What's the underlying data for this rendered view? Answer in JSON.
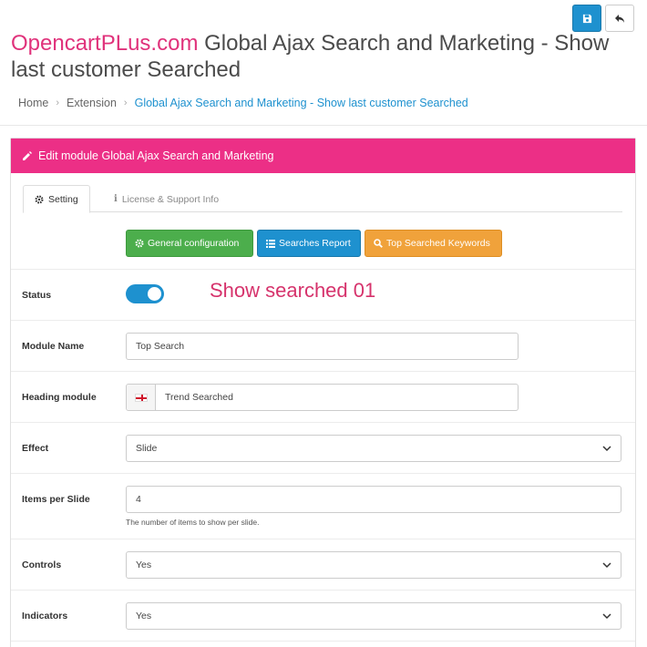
{
  "header": {
    "brand": "OpencartPLus.com",
    "title_rest": " Global Ajax Search and Marketing - Show last customer Searched",
    "save_icon": "save-icon",
    "back_icon": "reply-icon"
  },
  "breadcrumb": {
    "items": [
      "Home",
      "Extension",
      "Global Ajax Search and Marketing - Show last customer Searched"
    ]
  },
  "panel": {
    "heading": "Edit module Global Ajax Search and Marketing",
    "accent_color": "#ec2f86"
  },
  "tabs": [
    {
      "label": "Setting",
      "icon": "cog-icon"
    },
    {
      "label": "License & Support Info",
      "icon": "info-icon"
    }
  ],
  "actions": [
    {
      "label": "General configuration",
      "icon": "cog-icon",
      "color": "#4cae4c"
    },
    {
      "label": "Searches Report",
      "icon": "list-icon",
      "color": "#1e91cf"
    },
    {
      "label": "Top Searched Keywords",
      "icon": "search-icon",
      "color": "#f0a23b"
    }
  ],
  "form": {
    "status": {
      "label": "Status",
      "enabled": true
    },
    "annotation": "Show searched 01",
    "module_name": {
      "label": "Module Name",
      "value": "Top Search"
    },
    "heading_module": {
      "label": "Heading module",
      "value": "Trend Searched",
      "flag": "en-gb-flag"
    },
    "effect": {
      "label": "Effect",
      "value": "Slide"
    },
    "items_per_slide": {
      "label": "Items per Slide",
      "value": "4",
      "help": "The number of items to show per slide."
    },
    "controls": {
      "label": "Controls",
      "value": "Yes"
    },
    "indicators": {
      "label": "Indicators",
      "value": "Yes"
    }
  }
}
